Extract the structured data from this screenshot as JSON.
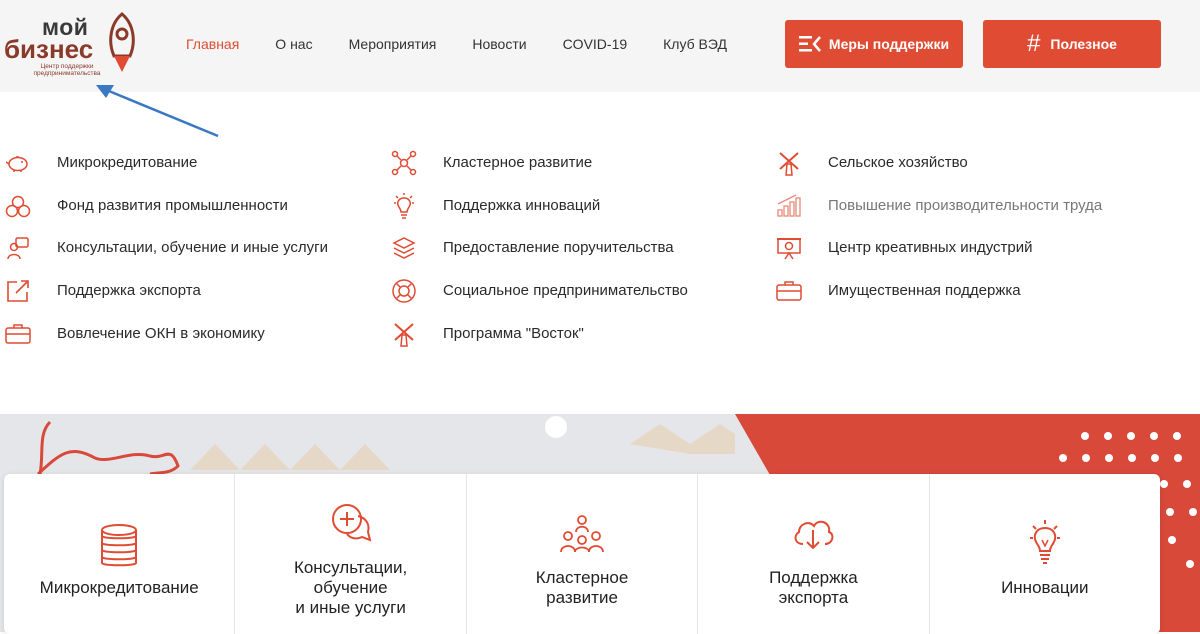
{
  "header": {
    "logo": {
      "line1": "мой",
      "line2": "бизнес",
      "subtitle": "Центр поддержки предпринимательства"
    },
    "nav": [
      {
        "label": "Главная",
        "active": true
      },
      {
        "label": "О нас"
      },
      {
        "label": "Мероприятия"
      },
      {
        "label": "Новости"
      },
      {
        "label": "COVID-19"
      },
      {
        "label": "Клуб ВЭД"
      }
    ],
    "support_button": "Меры поддержки",
    "useful_button": "Полезное",
    "accent_color": "#e04b33"
  },
  "menu": {
    "col1": [
      {
        "label": "Микрокредитование",
        "icon": "piggy-bank-icon"
      },
      {
        "label": "Фонд развития промышленности",
        "icon": "circles-icon"
      },
      {
        "label": "Консультации, обучение и иные услуги",
        "icon": "consultant-icon"
      },
      {
        "label": "Поддержка экспорта",
        "icon": "export-arrow-icon"
      },
      {
        "label": "Вовлечение ОКН в экономику",
        "icon": "briefcase-icon"
      }
    ],
    "col2": [
      {
        "label": "Кластерное развитие",
        "icon": "network-icon"
      },
      {
        "label": "Поддержка инноваций",
        "icon": "lightbulb-icon"
      },
      {
        "label": "Предоставление поручительства",
        "icon": "layers-icon"
      },
      {
        "label": "Социальное предпринимательство",
        "icon": "lifebuoy-icon"
      },
      {
        "label": "Программа \"Восток\"",
        "icon": "windmill-icon"
      }
    ],
    "col3": [
      {
        "label": "Сельское хозяйство",
        "icon": "windmill-icon"
      },
      {
        "label": "Повышение производительности труда",
        "icon": "bar-chart-icon",
        "muted": true
      },
      {
        "label": "Центр креативных индустрий",
        "icon": "presentation-icon"
      },
      {
        "label": "Имущественная поддержка",
        "icon": "briefcase-icon"
      }
    ]
  },
  "cards": [
    {
      "title": "Микрокредитование",
      "icon": "coins-icon"
    },
    {
      "title": "Консультации,\nобучение\nи иные услуги",
      "icon": "chat-plus-icon"
    },
    {
      "title": "Кластерное\nразвитие",
      "icon": "team-icon"
    },
    {
      "title": "Поддержка\nэкспорта",
      "icon": "cloud-download-icon"
    },
    {
      "title": "Инновации",
      "icon": "lightbulb-icon"
    }
  ]
}
